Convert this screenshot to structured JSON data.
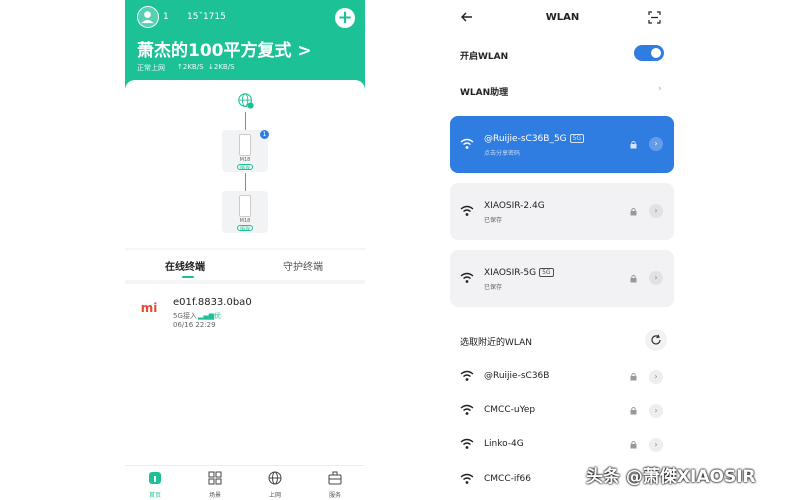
{
  "left": {
    "header": {
      "num1": "1",
      "num2": "15ˇ1715",
      "home_name": "萧杰的100平方复式 >",
      "status": "正常上网",
      "upload": "↑2KB/S",
      "download": "↓2KB/S"
    },
    "topology": {
      "router1_label": "M18",
      "router2_label": "M18",
      "new_tag": "NEW",
      "badge": "1"
    },
    "tabs": {
      "online": "在线终端",
      "protected": "守护终端"
    },
    "device": {
      "logo": "mi",
      "mac": "e01f.8833.0ba0",
      "band": "5G接入",
      "signal": "优",
      "time": "06/16 22:29"
    },
    "nav": [
      {
        "label": "首页",
        "icon": "home-icon"
      },
      {
        "label": "场景",
        "icon": "grid-icon"
      },
      {
        "label": "上网",
        "icon": "globe-icon"
      },
      {
        "label": "服务",
        "icon": "briefcase-icon"
      }
    ],
    "accent": "#1dc196"
  },
  "right": {
    "title": "WLAN",
    "wlan_on_label": "开启WLAN",
    "wlan_on": true,
    "assistant_label": "WLAN助理",
    "saved_networks": [
      {
        "ssid": "@Ruijie-sC36B_5G",
        "tag": "5G",
        "sub": "点击分享密码",
        "connected": true
      },
      {
        "ssid": "XIAOSIR-2.4G",
        "tag": "",
        "sub": "已保存",
        "connected": false
      },
      {
        "ssid": "XIAOSIR-5G",
        "tag": "5G",
        "sub": "已保存",
        "connected": false
      }
    ],
    "nearby_label": "选取附近的WLAN",
    "nearby": [
      {
        "ssid": "@Ruijie-sC36B"
      },
      {
        "ssid": "CMCC-uYep"
      },
      {
        "ssid": "Linko-4G"
      },
      {
        "ssid": "CMCC-if66"
      }
    ],
    "accent": "#2f7de1"
  },
  "watermark": "头条 @萧傑XIAOSIR"
}
